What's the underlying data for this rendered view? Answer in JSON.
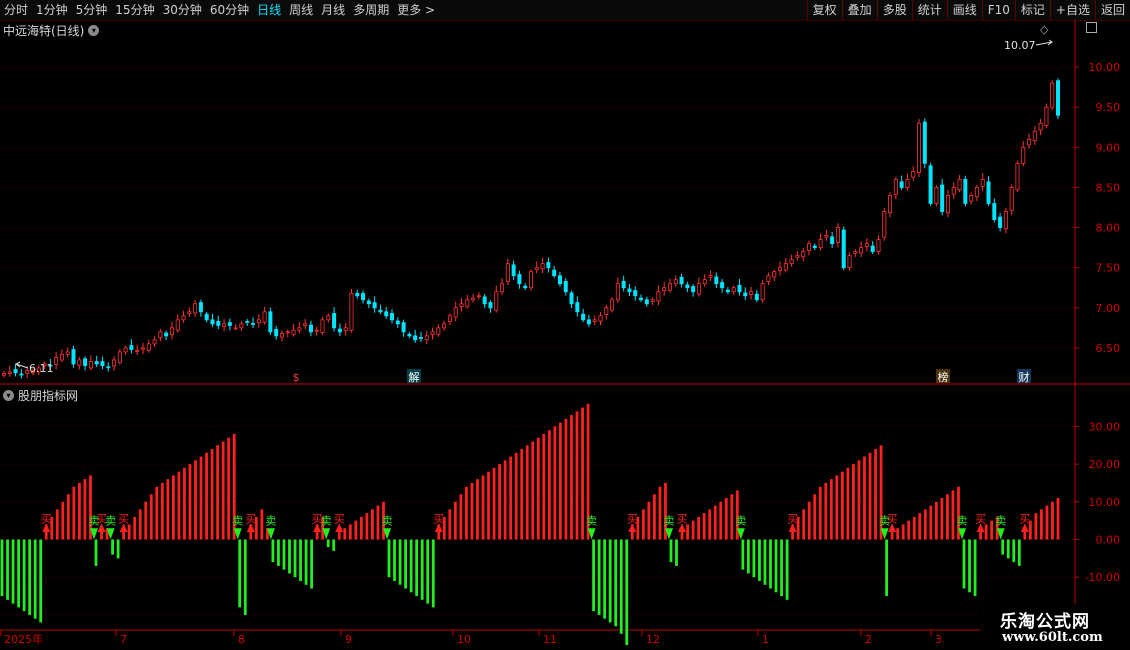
{
  "toolbar": {
    "left_items": [
      "分时",
      "1分钟",
      "5分钟",
      "15分钟",
      "30分钟",
      "60分钟",
      "日线",
      "周线",
      "月线",
      "多周期",
      "更多 >"
    ],
    "active": "日线",
    "right_items": [
      "复权",
      "叠加",
      "多股",
      "统计",
      "画线",
      "F10",
      "标记",
      "+自选",
      "返回"
    ]
  },
  "main_chart": {
    "title": "中远海特(日线)",
    "high_label": "10.07",
    "low_label": "6.11",
    "y_ticks": [
      "10.00",
      "9.50",
      "9.00",
      "8.50",
      "8.00",
      "7.50",
      "7.00",
      "6.50"
    ],
    "markers": [
      "$",
      "解",
      "榜",
      "财"
    ],
    "colors": {
      "up": "#ff3333",
      "down": "#00e5ff",
      "grid": "#5a0000",
      "axis": "#c00000"
    }
  },
  "indicator": {
    "title": "股朋指标网",
    "y_ticks": [
      "30.00",
      "20.00",
      "10.00",
      "0.00",
      "-10.00",
      "-20.00"
    ],
    "buy_label": "买",
    "sell_label": "卖",
    "colors": {
      "positive": "#ff2020",
      "negative": "#22ee22"
    }
  },
  "x_axis": {
    "labels": [
      "2025年",
      "7",
      "8",
      "9",
      "10",
      "11",
      "12",
      "1",
      "2",
      "3"
    ]
  },
  "chart_data": [
    {
      "type": "candlestick",
      "title": "中远海特(日线)",
      "ylim": [
        6.1,
        10.4
      ],
      "closes": [
        6.18,
        6.2,
        6.19,
        6.17,
        6.22,
        6.2,
        6.25,
        6.3,
        6.28,
        6.38,
        6.42,
        6.45,
        6.3,
        6.35,
        6.28,
        6.33,
        6.3,
        6.28,
        6.26,
        6.35,
        6.45,
        6.5,
        6.48,
        6.47,
        6.5,
        6.55,
        6.6,
        6.7,
        6.65,
        6.75,
        6.85,
        6.9,
        6.95,
        7.05,
        6.95,
        6.85,
        6.8,
        6.78,
        6.8,
        6.78,
        6.75,
        6.8,
        6.82,
        6.8,
        6.85,
        6.95,
        6.7,
        6.65,
        6.68,
        6.7,
        6.72,
        6.75,
        6.8,
        6.7,
        6.72,
        6.85,
        6.9,
        6.75,
        6.7,
        6.75,
        7.18,
        7.15,
        7.1,
        7.05,
        7.0,
        6.95,
        6.9,
        6.85,
        6.8,
        6.7,
        6.65,
        6.6,
        6.62,
        6.65,
        6.7,
        6.75,
        6.8,
        6.9,
        7.0,
        7.05,
        7.1,
        7.12,
        7.15,
        7.05,
        7.0,
        7.2,
        7.3,
        7.55,
        7.4,
        7.3,
        7.25,
        7.45,
        7.5,
        7.55,
        7.5,
        7.4,
        7.3,
        7.2,
        7.05,
        6.95,
        6.85,
        6.8,
        6.85,
        6.9,
        7.0,
        7.1,
        7.3,
        7.25,
        7.2,
        7.15,
        7.1,
        7.05,
        7.1,
        7.2,
        7.25,
        7.3,
        7.35,
        7.3,
        7.25,
        7.2,
        7.3,
        7.35,
        7.4,
        7.3,
        7.25,
        7.2,
        7.25,
        7.2,
        7.15,
        7.2,
        7.1,
        7.3,
        7.4,
        7.45,
        7.5,
        7.55,
        7.6,
        7.65,
        7.7,
        7.8,
        7.75,
        7.85,
        7.9,
        7.8,
        8.0,
        7.5,
        7.65,
        7.7,
        7.75,
        7.8,
        7.7,
        7.85,
        8.2,
        8.4,
        8.6,
        8.5,
        8.6,
        8.7,
        9.3,
        8.8,
        8.3,
        8.5,
        8.2,
        8.4,
        8.5,
        8.6,
        8.3,
        8.4,
        8.5,
        8.6,
        8.3,
        8.1,
        8.0,
        8.2,
        8.5,
        8.8,
        9.0,
        9.1,
        9.2,
        9.3,
        9.5,
        9.8,
        9.4
      ]
    },
    {
      "type": "bar",
      "title": "股朋指标网",
      "ylim": [
        -24,
        37
      ],
      "values": [
        -15,
        -16,
        -17,
        -18,
        -19,
        -20,
        -21,
        -22,
        4,
        6,
        8,
        10,
        12,
        14,
        15,
        16,
        17,
        -7,
        2,
        3,
        -4,
        -5,
        2,
        4,
        6,
        8,
        10,
        12,
        14,
        15,
        16,
        17,
        18,
        19,
        20,
        21,
        22,
        23,
        24,
        25,
        26,
        27,
        28,
        -18,
        -20,
        4,
        6,
        8,
        3,
        -6,
        -7,
        -8,
        -9,
        -10,
        -11,
        -12,
        -13,
        4,
        6,
        -2,
        -3,
        2,
        3,
        4,
        5,
        6,
        7,
        8,
        9,
        10,
        -10,
        -11,
        -12,
        -13,
        -14,
        -15,
        -16,
        -17,
        -18,
        4,
        6,
        8,
        10,
        12,
        14,
        15,
        16,
        17,
        18,
        19,
        20,
        21,
        22,
        23,
        24,
        25,
        26,
        27,
        28,
        29,
        30,
        31,
        32,
        33,
        34,
        35,
        36,
        -19,
        -20,
        -21,
        -22,
        -23,
        -25,
        -28,
        4,
        6,
        8,
        10,
        12,
        14,
        15,
        -6,
        -7,
        3,
        4,
        5,
        6,
        7,
        8,
        9,
        10,
        11,
        12,
        13,
        -8,
        -9,
        -10,
        -11,
        -12,
        -13,
        -14,
        -15,
        -16,
        4,
        6,
        8,
        10,
        12,
        14,
        15,
        16,
        17,
        18,
        19,
        20,
        21,
        22,
        23,
        24,
        25,
        -15,
        2,
        3,
        4,
        5,
        6,
        7,
        8,
        9,
        10,
        11,
        12,
        13,
        14,
        -13,
        -14,
        -15,
        3,
        4,
        5,
        6,
        -4,
        -5,
        -6,
        -7,
        3,
        5,
        7,
        8,
        9,
        10,
        11
      ]
    }
  ]
}
